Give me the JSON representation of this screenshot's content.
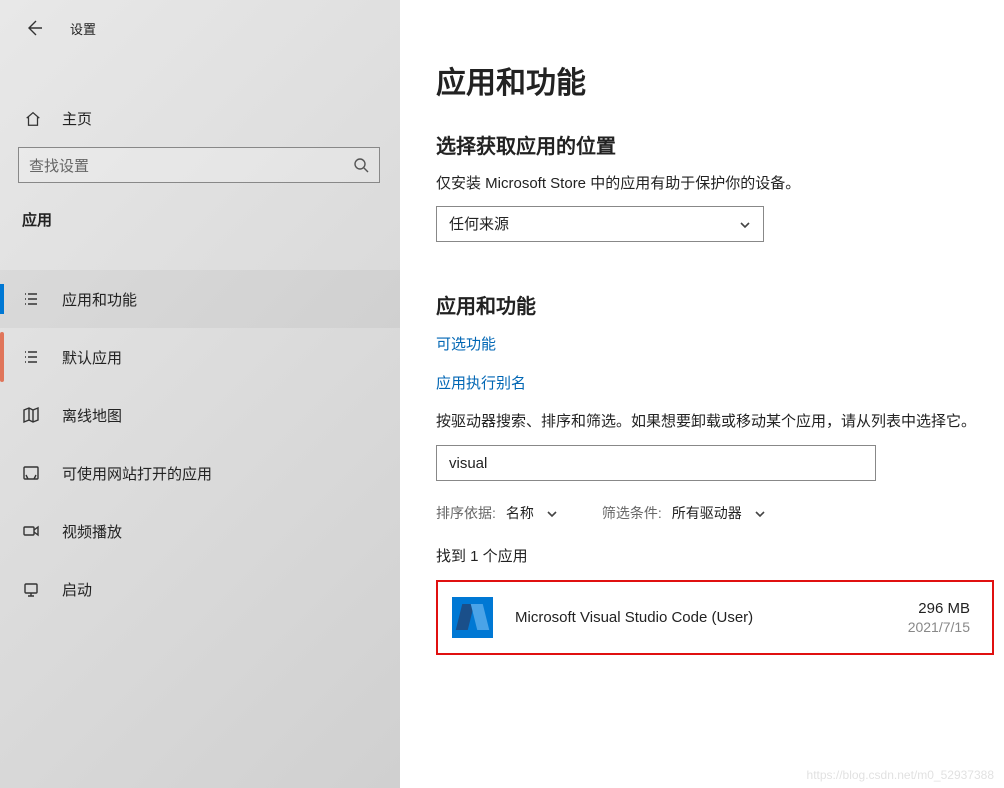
{
  "header": {
    "title": "设置"
  },
  "sidebar": {
    "home": "主页",
    "search_placeholder": "查找设置",
    "section": "应用",
    "items": [
      {
        "label": "应用和功能"
      },
      {
        "label": "默认应用"
      },
      {
        "label": "离线地图"
      },
      {
        "label": "可使用网站打开的应用"
      },
      {
        "label": "视频播放"
      },
      {
        "label": "启动"
      }
    ]
  },
  "main": {
    "title": "应用和功能",
    "source_title": "选择获取应用的位置",
    "source_desc": "仅安装 Microsoft Store 中的应用有助于保护你的设备。",
    "source_value": "任何来源",
    "features_title": "应用和功能",
    "link_optional": "可选功能",
    "link_alias": "应用执行别名",
    "filter_desc": "按驱动器搜索、排序和筛选。如果想要卸载或移动某个应用，请从列表中选择它。",
    "filter_value": "visual",
    "sort_label": "排序依据:",
    "sort_value": "名称",
    "filter_label": "筛选条件:",
    "filter_drive": "所有驱动器",
    "found": "找到 1 个应用",
    "app": {
      "name": "Microsoft Visual Studio Code (User)",
      "size": "296 MB",
      "date": "2021/7/15"
    }
  },
  "watermark": "https://blog.csdn.net/m0_52937388"
}
